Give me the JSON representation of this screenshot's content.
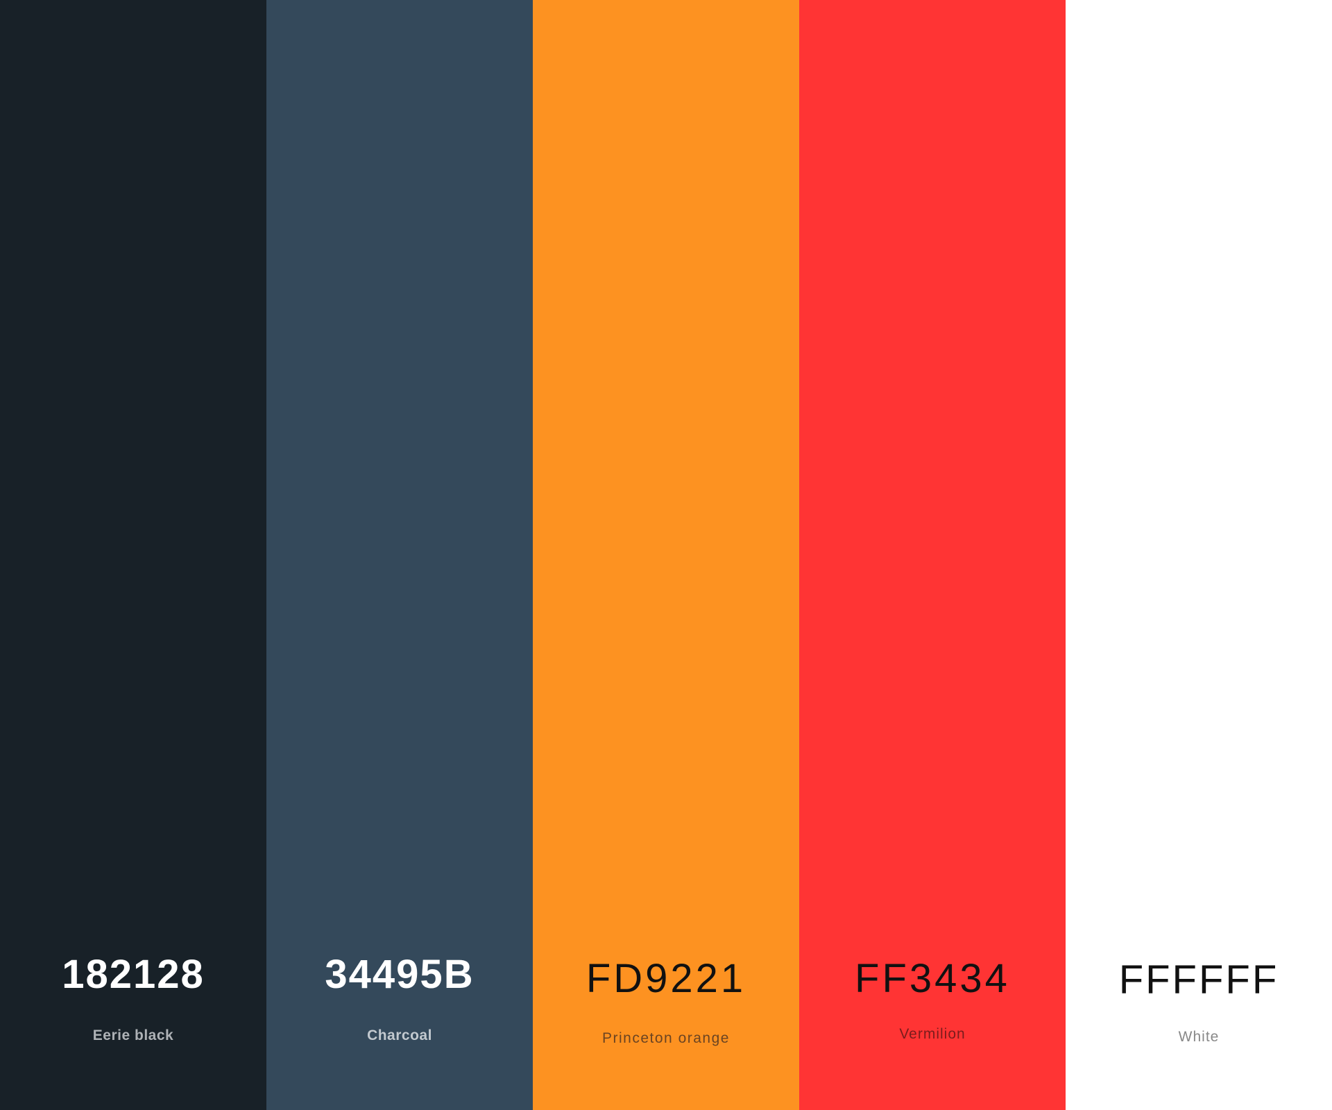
{
  "palette": {
    "swatches": [
      {
        "hex_label": "182128",
        "name": "Eerie black",
        "color": "#182128"
      },
      {
        "hex_label": "34495B",
        "name": "Charcoal",
        "color": "#34495B"
      },
      {
        "hex_label": "FD9221",
        "name": "Princeton orange",
        "color": "#FD9221"
      },
      {
        "hex_label": "FF3434",
        "name": "Vermilion",
        "color": "#FF3434"
      },
      {
        "hex_label": "FFFFFF",
        "name": "White",
        "color": "#FFFFFF"
      }
    ]
  }
}
